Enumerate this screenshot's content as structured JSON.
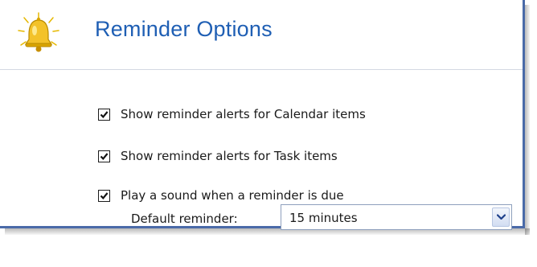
{
  "header": {
    "title": "Reminder Options",
    "icon": "bell-icon"
  },
  "options": [
    {
      "label": "Show reminder alerts for Calendar items",
      "checked": true
    },
    {
      "label": "Show reminder alerts for Task items",
      "checked": true
    },
    {
      "label": "Play a sound when a reminder is due",
      "checked": true
    }
  ],
  "default_reminder": {
    "label": "Default reminder:",
    "value": "15 minutes"
  },
  "colors": {
    "title": "#1f5fb4",
    "frame": "#4a6aa8",
    "bell": "#f3c22a"
  }
}
